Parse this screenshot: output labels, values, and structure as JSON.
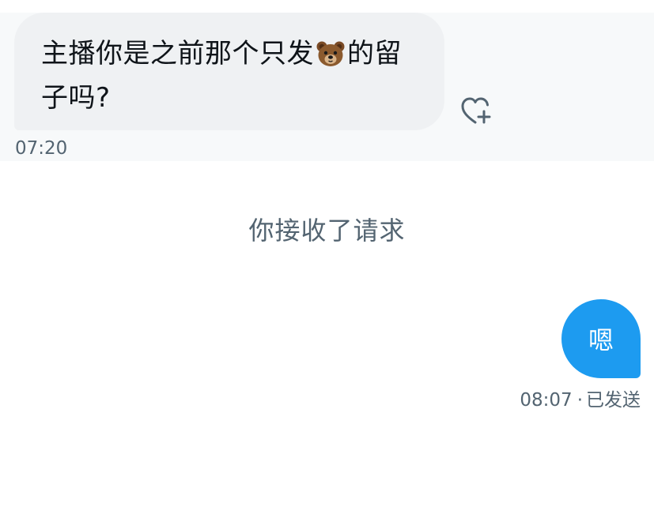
{
  "incoming_message": {
    "text_before_emoji": "主播你是之前那个只发",
    "emoji_icon": "bear-face-icon",
    "text_after_emoji": "的留子吗?",
    "time": "07:20",
    "like_icon": "heart-plus-icon"
  },
  "system_note": "你接收了请求",
  "outgoing_message": {
    "text": "嗯",
    "time": "08:07",
    "separator": "·",
    "status": "已发送"
  },
  "colors": {
    "outgoing_bubble": "#1d9bf0",
    "incoming_bubble": "#eff1f3",
    "secondary_text": "#536471"
  }
}
